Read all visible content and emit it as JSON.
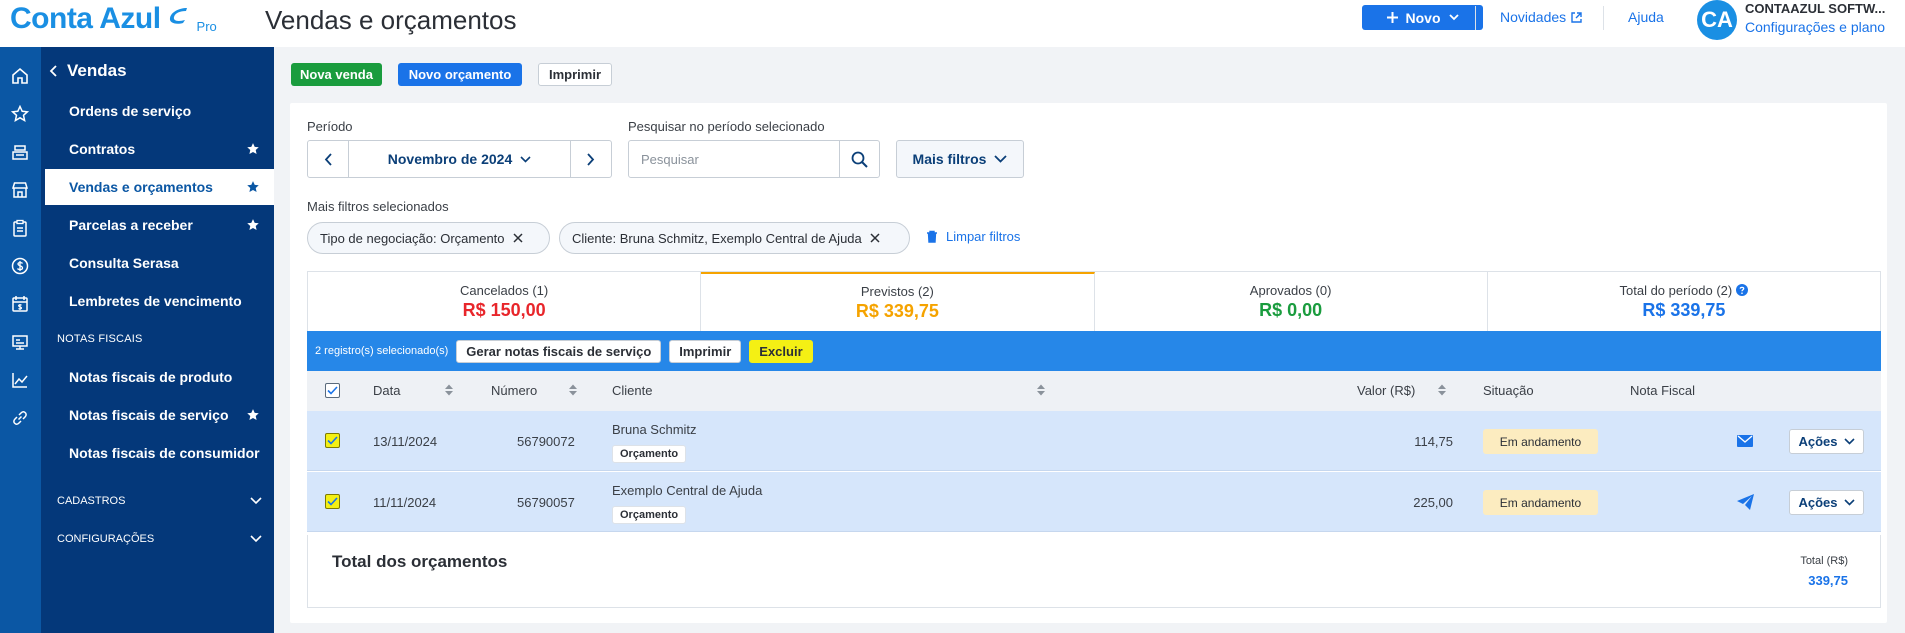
{
  "brand": {
    "name": "Conta Azul",
    "tier": "Pro"
  },
  "header": {
    "title": "Vendas e orçamentos",
    "new_button": "Novo",
    "novidades": "Novidades",
    "ajuda": "Ajuda",
    "avatar_initials": "CA",
    "company_name": "CONTAAZUL SOFTW...",
    "company_link": "Configurações e plano"
  },
  "rail_icons": [
    "home-icon",
    "star-icon",
    "cash-register-icon",
    "store-icon",
    "clipboard-icon",
    "dollar-icon",
    "calendar-dollar-icon",
    "receipt-icon",
    "chart-line-icon",
    "link-icon"
  ],
  "sidebar": {
    "title": "Vendas",
    "items": [
      {
        "label": "Ordens de serviço",
        "starred": false
      },
      {
        "label": "Contratos",
        "starred": true
      },
      {
        "label": "Vendas e orçamentos",
        "starred": true,
        "active": true
      },
      {
        "label": "Parcelas a receber",
        "starred": true
      },
      {
        "label": "Consulta Serasa",
        "starred": false
      },
      {
        "label": "Lembretes de vencimento",
        "starred": false
      }
    ],
    "section_notas": "NOTAS FISCAIS",
    "notas_items": [
      {
        "label": "Notas fiscais de produto",
        "starred": false
      },
      {
        "label": "Notas fiscais de serviço",
        "starred": true
      },
      {
        "label": "Notas fiscais de consumidor",
        "starred": false
      }
    ],
    "group_cadastros": "CADASTROS",
    "group_config": "CONFIGURAÇÕES"
  },
  "actions": {
    "nova_venda": "Nova venda",
    "novo_orcamento": "Novo orçamento",
    "imprimir": "Imprimir"
  },
  "filters": {
    "period_label": "Período",
    "period_value": "Novembro de 2024",
    "search_label": "Pesquisar no período selecionado",
    "search_placeholder": "Pesquisar",
    "more_filters": "Mais filtros",
    "selected_label": "Mais filtros selecionados",
    "chips": [
      "Tipo de negociação: Orçamento",
      "Cliente: Bruna Schmitz, Exemplo Central de Ajuda"
    ],
    "clear": "Limpar filtros"
  },
  "summary": [
    {
      "label": "Cancelados (1)",
      "value": "R$ 150,00",
      "color": "#e8262b"
    },
    {
      "label": "Previstos (2)",
      "value": "R$ 339,75",
      "color": "#f5a300"
    },
    {
      "label": "Aprovados (0)",
      "value": "R$ 0,00",
      "color": "#1a9c3e"
    },
    {
      "label": "Total do período (2)",
      "value": "R$ 339,75",
      "color": "#1a73e8"
    }
  ],
  "selection": {
    "count": "2 registro(s) selecionado(s)",
    "gerar": "Gerar notas fiscais de serviço",
    "imprimir": "Imprimir",
    "excluir": "Excluir"
  },
  "table": {
    "headers": {
      "data": "Data",
      "numero": "Número",
      "cliente": "Cliente",
      "valor": "Valor (R$)",
      "situacao": "Situação",
      "nota": "Nota Fiscal"
    },
    "rows": [
      {
        "date": "13/11/2024",
        "number": "56790072",
        "client": "Bruna Schmitz",
        "type": "Orçamento",
        "value": "114,75",
        "status": "Em andamento",
        "nf_icon": "envelope-icon",
        "acoes": "Ações"
      },
      {
        "date": "11/11/2024",
        "number": "56790057",
        "client": "Exemplo Central de Ajuda",
        "type": "Orçamento",
        "value": "225,00",
        "status": "Em andamento",
        "nf_icon": "paper-plane-icon",
        "acoes": "Ações"
      }
    ]
  },
  "totals": {
    "title": "Total dos orçamentos",
    "label": "Total (R$)",
    "value": "339,75"
  }
}
